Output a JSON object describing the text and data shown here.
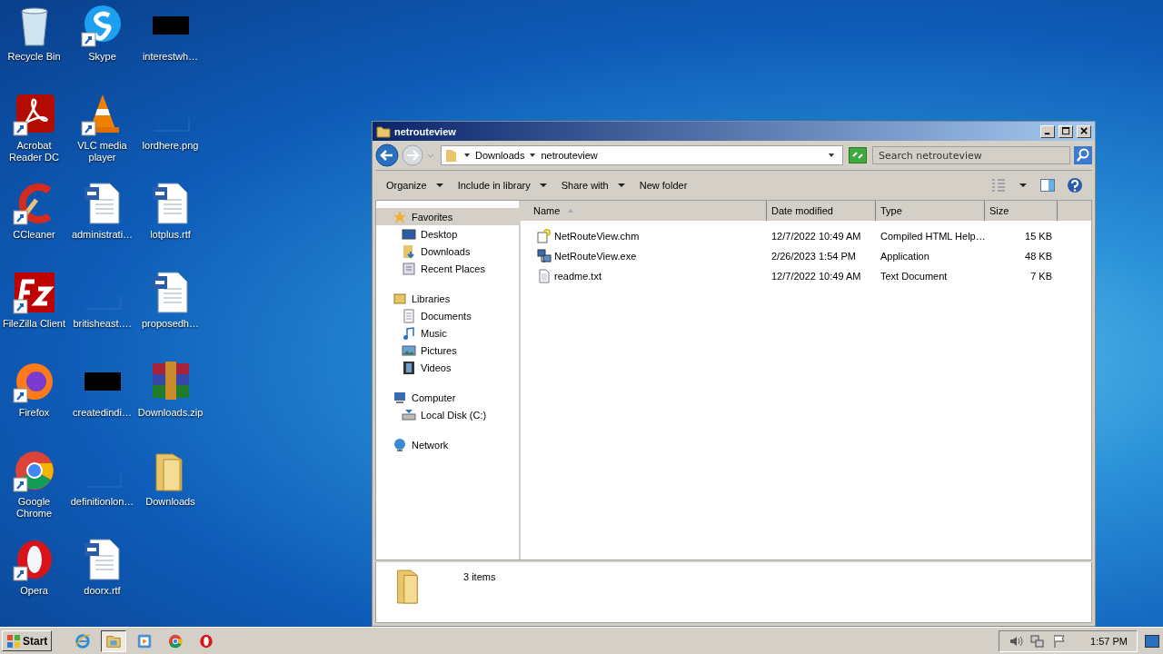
{
  "desktop_icons": [
    {
      "label": "Recycle Bin",
      "kind": "recycle",
      "shortcut": false
    },
    {
      "label": "Skype",
      "kind": "skype",
      "shortcut": true
    },
    {
      "label": "interestwh…",
      "kind": "dark",
      "shortcut": false
    },
    {
      "label": "Acrobat Reader DC",
      "kind": "acrobat",
      "shortcut": true
    },
    {
      "label": "VLC media player",
      "kind": "vlc",
      "shortcut": true
    },
    {
      "label": "lordhere.png",
      "kind": "blank",
      "shortcut": false
    },
    {
      "label": "CCleaner",
      "kind": "ccleaner",
      "shortcut": true
    },
    {
      "label": "administrati…",
      "kind": "word",
      "shortcut": false
    },
    {
      "label": "lotplus.rtf",
      "kind": "word",
      "shortcut": false
    },
    {
      "label": "FileZilla Client",
      "kind": "filezilla",
      "shortcut": true
    },
    {
      "label": "britisheast….",
      "kind": "blank",
      "shortcut": false
    },
    {
      "label": "proposedh…",
      "kind": "word",
      "shortcut": false
    },
    {
      "label": "Firefox",
      "kind": "firefox",
      "shortcut": true
    },
    {
      "label": "createdindi…",
      "kind": "dark",
      "shortcut": false
    },
    {
      "label": "Downloads.zip",
      "kind": "archive",
      "shortcut": false
    },
    {
      "label": "Google Chrome",
      "kind": "chrome",
      "shortcut": true
    },
    {
      "label": "definitionlon…",
      "kind": "blank",
      "shortcut": false
    },
    {
      "label": "Downloads",
      "kind": "folder",
      "shortcut": false
    },
    {
      "label": "Opera",
      "kind": "opera",
      "shortcut": true
    },
    {
      "label": "doorx.rtf",
      "kind": "word",
      "shortcut": false
    }
  ],
  "window": {
    "title": "netrouteview",
    "breadcrumb": [
      "Downloads",
      "netrouteview"
    ],
    "search": {
      "placeholder": "Search netrouteview"
    },
    "toolbar": [
      {
        "label": "Organize",
        "dropdown": true
      },
      {
        "label": "Include in library",
        "dropdown": true
      },
      {
        "label": "Share with",
        "dropdown": true
      },
      {
        "label": "New folder",
        "dropdown": false
      }
    ],
    "sidebar": [
      {
        "label": "Favorites",
        "kind": "star",
        "selected": true,
        "children": [
          {
            "label": "Desktop",
            "kind": "desktop",
            "selected": false
          },
          {
            "label": "Downloads",
            "kind": "downloads",
            "selected": false
          },
          {
            "label": "Recent Places",
            "kind": "recent",
            "selected": false
          }
        ]
      },
      {
        "label": "Libraries",
        "kind": "library",
        "selected": false,
        "children": [
          {
            "label": "Documents",
            "kind": "document",
            "selected": false
          },
          {
            "label": "Music",
            "kind": "music",
            "selected": false
          },
          {
            "label": "Pictures",
            "kind": "picture",
            "selected": false
          },
          {
            "label": "Videos",
            "kind": "video",
            "selected": false
          }
        ]
      },
      {
        "label": "Computer",
        "kind": "computer",
        "selected": false,
        "children": [
          {
            "label": "Local Disk (C:)",
            "kind": "disk",
            "selected": false
          }
        ]
      },
      {
        "label": "Network",
        "kind": "network",
        "selected": false
      }
    ],
    "columns": [
      {
        "label": "Name",
        "sorted": true
      },
      {
        "label": "Date modified",
        "sorted": false
      },
      {
        "label": "Type",
        "sorted": false
      },
      {
        "label": "Size",
        "sorted": false
      }
    ],
    "files": [
      {
        "name": "NetRouteView.chm",
        "date": "12/7/2022 10:49 AM",
        "type": "Compiled HTML Help…",
        "size": "15 KB",
        "kind": "help"
      },
      {
        "name": "NetRouteView.exe",
        "date": "2/26/2023 1:54 PM",
        "type": "Application",
        "size": "48 KB",
        "kind": "app"
      },
      {
        "name": "readme.txt",
        "date": "12/7/2022 10:49 AM",
        "type": "Text Document",
        "size": "7 KB",
        "kind": "text"
      }
    ],
    "status": "3 items"
  },
  "taskbar": {
    "start": "Start",
    "apps": [
      {
        "kind": "ie",
        "selected": false
      },
      {
        "kind": "explorer",
        "selected": true
      },
      {
        "kind": "media",
        "selected": false
      },
      {
        "kind": "chrome",
        "selected": false
      },
      {
        "kind": "opera",
        "selected": false
      }
    ],
    "clock": "1:57 PM"
  }
}
